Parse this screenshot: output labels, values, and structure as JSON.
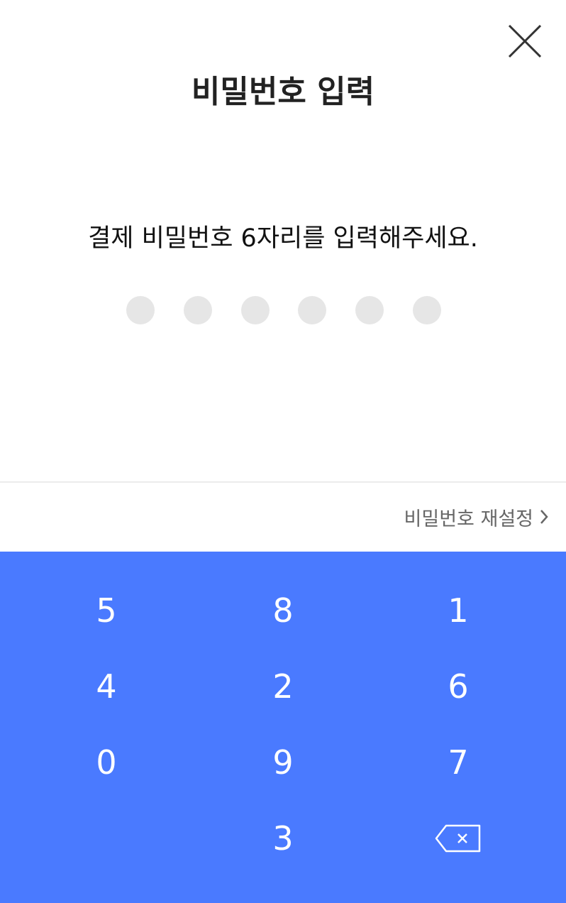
{
  "header": {
    "title": "비밀번호 입력",
    "close_icon": "close-icon"
  },
  "prompt": {
    "text": "결제 비밀번호 6자리를 입력해주세요."
  },
  "pin": {
    "length": 6,
    "filled": 0,
    "dot_color": "#e6e6e6"
  },
  "reset": {
    "label": "비밀번호 재설정",
    "chevron_icon": "chevron-right-icon"
  },
  "keypad": {
    "background": "#4a7aff",
    "rows": [
      [
        "5",
        "8",
        "1"
      ],
      [
        "4",
        "2",
        "6"
      ],
      [
        "0",
        "9",
        "7"
      ],
      [
        "",
        "3",
        "backspace"
      ]
    ],
    "backspace_icon": "backspace-icon"
  }
}
